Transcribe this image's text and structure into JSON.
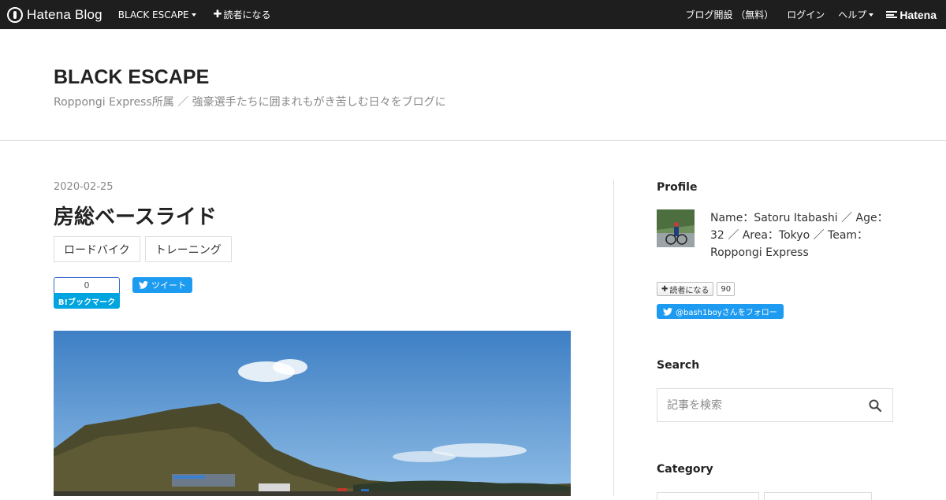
{
  "topbar": {
    "logo_text": "Hatena Blog",
    "blog_menu": "BLACK ESCAPE",
    "subscribe": "読者になる",
    "open_blog": "ブログ開設 （無料）",
    "login": "ログイン",
    "help": "ヘルプ",
    "hatena": "Hatena"
  },
  "header": {
    "title": "BLACK ESCAPE",
    "description": "Roppongi Express所属 ／ 強豪選手たちに囲まれもがき苦しむ日々をブログに"
  },
  "entry": {
    "date": "2020-02-25",
    "title": "房総ベースライド",
    "categories": [
      "ロードバイク",
      "トレーニング"
    ],
    "bookmark_count": "0",
    "bookmark_label": "B!ブックマーク",
    "tweet_label": "ツイート"
  },
  "sidebar": {
    "profile_title": "Profile",
    "profile_text": "Name：Satoru Itabashi ／ Age：32 ／ Area：Tokyo ／ Team：Roppongi Express",
    "subscribe_label": "読者になる",
    "subscribe_count": "90",
    "follow_label": "@bash1boyさんをフォロー",
    "search_title": "Search",
    "search_placeholder": "記事を検索",
    "category_title": "Category"
  }
}
